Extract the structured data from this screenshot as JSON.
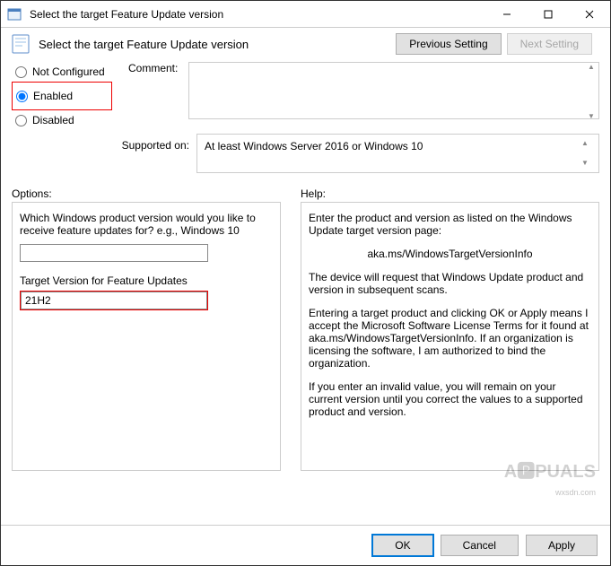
{
  "window": {
    "title": "Select the target Feature Update version"
  },
  "header": {
    "title": "Select the target Feature Update version",
    "prev_label": "Previous Setting",
    "next_label": "Next Setting"
  },
  "state": {
    "not_configured": "Not Configured",
    "enabled": "Enabled",
    "disabled": "Disabled",
    "selected": "enabled"
  },
  "comment": {
    "label": "Comment:",
    "value": ""
  },
  "supported": {
    "label": "Supported on:",
    "value": "At least Windows Server 2016 or Windows 10"
  },
  "panes": {
    "options_label": "Options:",
    "help_label": "Help:"
  },
  "options": {
    "product_question": "Which Windows product version would you like to receive feature updates for? e.g., Windows 10",
    "product_value": "",
    "target_label": "Target Version for Feature Updates",
    "target_value": "21H2"
  },
  "help": {
    "p1": "Enter the product and version as listed on the Windows Update target version page:",
    "link": "aka.ms/WindowsTargetVersionInfo",
    "p2": "The device will request that Windows Update product and version in subsequent scans.",
    "p3": "Entering a target product and clicking OK or Apply means I accept the Microsoft Software License Terms for it found at aka.ms/WindowsTargetVersionInfo. If an organization is licensing the software, I am authorized to bind the organization.",
    "p4": "If you enter an invalid value, you will remain on your current version until you correct the values to a supported product and version."
  },
  "footer": {
    "ok": "OK",
    "cancel": "Cancel",
    "apply": "Apply"
  },
  "watermark": {
    "brand": "A🅿PUALS",
    "sub": "wxsdn.com"
  }
}
